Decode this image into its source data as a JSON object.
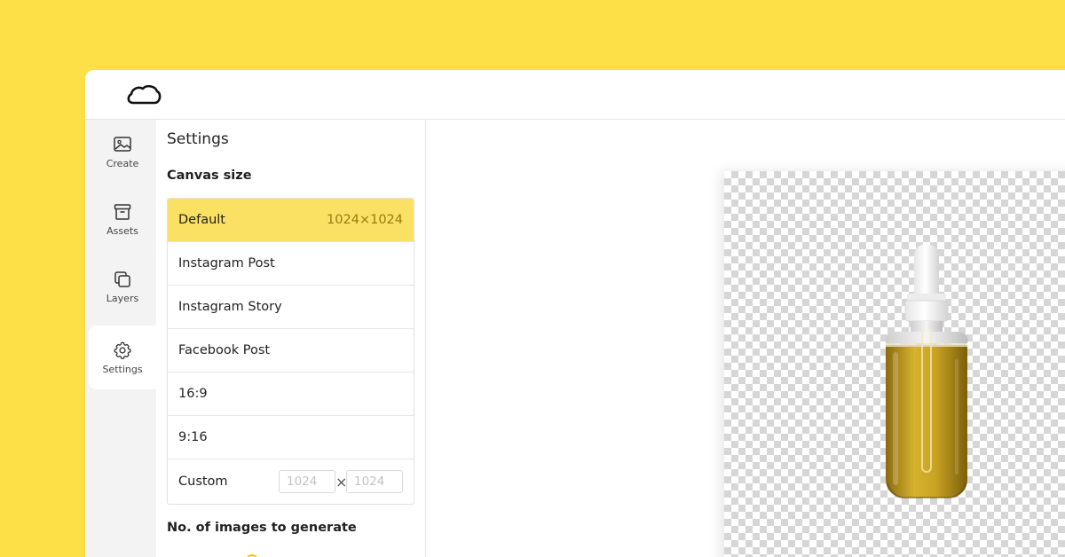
{
  "sidebar": {
    "items": [
      {
        "label": "Create",
        "icon": "image-icon"
      },
      {
        "label": "Assets",
        "icon": "archive-box-icon"
      },
      {
        "label": "Layers",
        "icon": "layers-icon"
      },
      {
        "label": "Settings",
        "icon": "gear-icon",
        "active": true
      }
    ]
  },
  "panel": {
    "title": "Settings",
    "canvas_size_title": "Canvas size",
    "sizes": [
      {
        "label": "Default",
        "dims": "1024×1024",
        "selected": true
      },
      {
        "label": "Instagram Post"
      },
      {
        "label": "Instagram Story"
      },
      {
        "label": "Facebook Post"
      },
      {
        "label": "16:9"
      },
      {
        "label": "9:16"
      },
      {
        "label": "Custom"
      }
    ],
    "custom": {
      "width_placeholder": "1024",
      "separator": "×",
      "height_placeholder": "1024"
    },
    "num_images_title": "No. of images to generate"
  },
  "colors": {
    "background": "#FDE047",
    "selected_row": "#FAE063",
    "accent": "#F2C500"
  }
}
